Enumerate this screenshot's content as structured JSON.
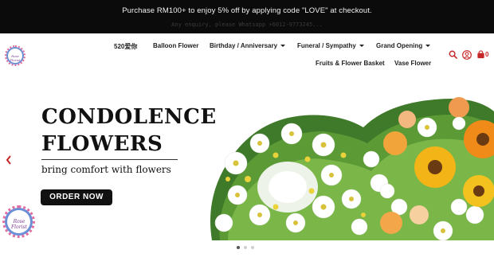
{
  "announcement": {
    "promo": "Purchase RM100+ to enjoy 5% off by applying code \"LOVE\" at checkout.",
    "enquiry": "Any enquiry, please Whatsapp +6012-9773245..."
  },
  "brand": {
    "logo_text": "Rose Florist"
  },
  "nav": {
    "items": [
      {
        "label": "520爱你"
      },
      {
        "label": "Balloon Flower"
      },
      {
        "label": "Birthday / Anniversary"
      },
      {
        "label": "Funeral / Sympathy"
      },
      {
        "label": "Grand Opening"
      },
      {
        "label": "Fruits & Flower Basket"
      },
      {
        "label": "Vase Flower"
      }
    ]
  },
  "header_icons": {
    "search": "search-icon",
    "account": "user-icon",
    "cart": "cart-icon",
    "cart_count": "0"
  },
  "hero": {
    "title_line1": "CONDOLENCE",
    "title_line2": "FLOWERS",
    "subtitle": "bring comfort with flowers",
    "button": "ORDER NOW",
    "slides_total": 3,
    "active_slide": 1
  },
  "colors": {
    "topbar": "#0b0b0b",
    "button": "#111111",
    "cart": "#c62828"
  }
}
